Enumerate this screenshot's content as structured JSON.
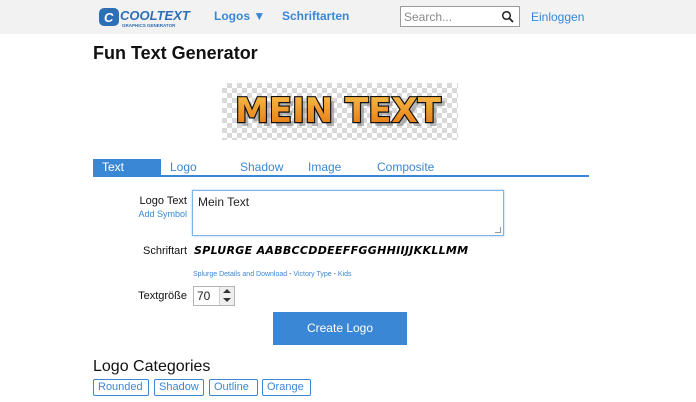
{
  "header": {
    "logo_text": "COOLTEXT",
    "logo_subtitle": "GRAPHICS GENERATOR",
    "nav": {
      "logos_label": "Logos ▼",
      "fonts_label": "Schriftarten"
    },
    "search": {
      "placeholder": "Search...",
      "value": ""
    },
    "login_label": "Einloggen"
  },
  "page": {
    "title": "Fun Text Generator",
    "preview_text": "MEIN TEXT"
  },
  "tabs": [
    {
      "label": "Text",
      "active": true
    },
    {
      "label": "Logo"
    },
    {
      "label": "Shadow"
    },
    {
      "label": "Image"
    },
    {
      "label": "Composite"
    }
  ],
  "form": {
    "logo_text_label": "Logo Text",
    "add_symbol_label": "Add Symbol",
    "logo_text_value": "Mein Text",
    "font_label": "Schriftart",
    "font_sample": "SPLURGE AABBCCDDEEFFGGHHIIJJKKLLMM",
    "font_links": {
      "details": "Splurge Details and Download",
      "separator1": " - ",
      "author": "Victory Type",
      "separator2": " - ",
      "category": "Kids"
    },
    "size_label": "Textgröße",
    "size_value": "70",
    "create_label": "Create Logo"
  },
  "categories": {
    "title": "Logo Categories",
    "items": [
      "Rounded",
      "Shadow",
      "Outline",
      "Orange"
    ]
  },
  "colors": {
    "accent": "#3a87d5",
    "header_bg": "#f2f2f2",
    "preview_fill_top": "#f7b13a",
    "preview_fill_bottom": "#e8740f"
  }
}
